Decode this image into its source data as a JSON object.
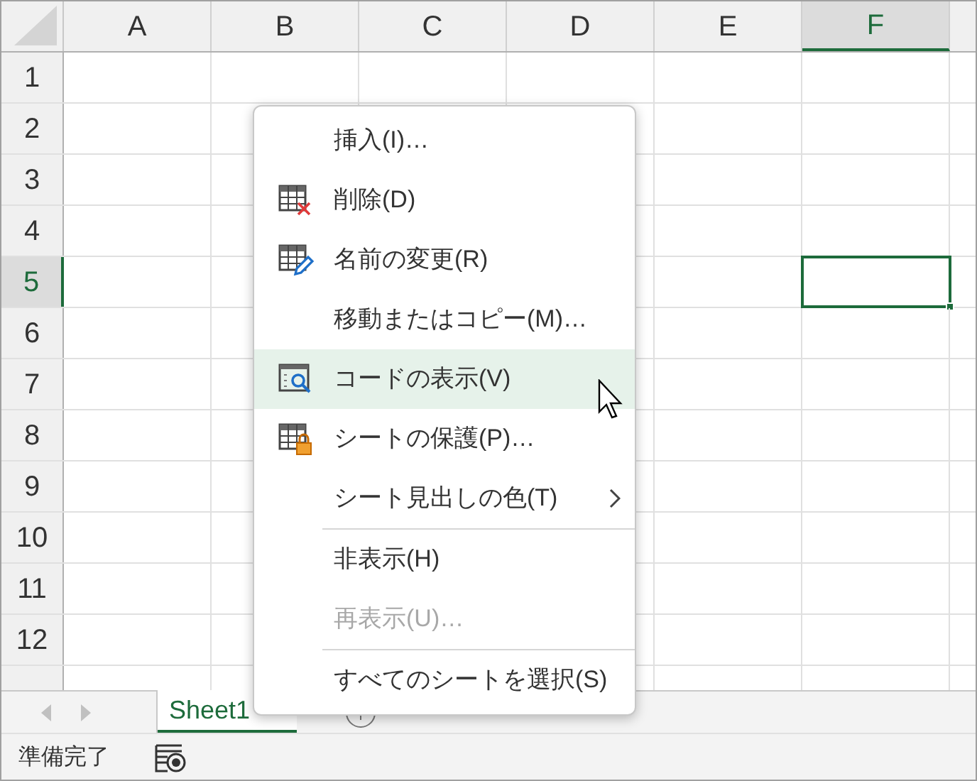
{
  "columns": [
    {
      "label": "A",
      "selected": false
    },
    {
      "label": "B",
      "selected": false
    },
    {
      "label": "C",
      "selected": false
    },
    {
      "label": "D",
      "selected": false
    },
    {
      "label": "E",
      "selected": false
    },
    {
      "label": "F",
      "selected": true
    }
  ],
  "rows": [
    {
      "label": "1",
      "selected": false
    },
    {
      "label": "2",
      "selected": false
    },
    {
      "label": "3",
      "selected": false
    },
    {
      "label": "4",
      "selected": false
    },
    {
      "label": "5",
      "selected": true
    },
    {
      "label": "6",
      "selected": false
    },
    {
      "label": "7",
      "selected": false
    },
    {
      "label": "8",
      "selected": false
    },
    {
      "label": "9",
      "selected": false
    },
    {
      "label": "10",
      "selected": false
    },
    {
      "label": "11",
      "selected": false
    },
    {
      "label": "12",
      "selected": false
    }
  ],
  "context_menu": {
    "items": [
      {
        "kind": "item",
        "label": "挿入(I)…",
        "selected": false,
        "disabled": false,
        "submenu": false
      },
      {
        "kind": "item",
        "label": "削除(D)",
        "selected": false,
        "disabled": false,
        "submenu": false
      },
      {
        "kind": "item",
        "label": "名前の変更(R)",
        "selected": false,
        "disabled": false,
        "submenu": false
      },
      {
        "kind": "item",
        "label": "移動またはコピー(M)…",
        "selected": false,
        "disabled": false,
        "submenu": false
      },
      {
        "kind": "item",
        "label": "コードの表示(V)",
        "selected": true,
        "disabled": false,
        "submenu": false
      },
      {
        "kind": "item",
        "label": "シートの保護(P)…",
        "selected": false,
        "disabled": false,
        "submenu": false
      },
      {
        "kind": "item",
        "label": "シート見出しの色(T)",
        "selected": false,
        "disabled": false,
        "submenu": true
      },
      {
        "kind": "separator"
      },
      {
        "kind": "item",
        "label": "非表示(H)",
        "selected": false,
        "disabled": false,
        "submenu": false
      },
      {
        "kind": "item",
        "label": "再表示(U)…",
        "selected": false,
        "disabled": true,
        "submenu": false
      },
      {
        "kind": "separator"
      },
      {
        "kind": "item",
        "label": "すべてのシートを選択(S)",
        "selected": false,
        "disabled": false,
        "submenu": false
      }
    ]
  },
  "sheet_tabs": [
    {
      "label": "Sheet1",
      "selected": true
    }
  ],
  "status_bar": {
    "text": "準備完了"
  }
}
